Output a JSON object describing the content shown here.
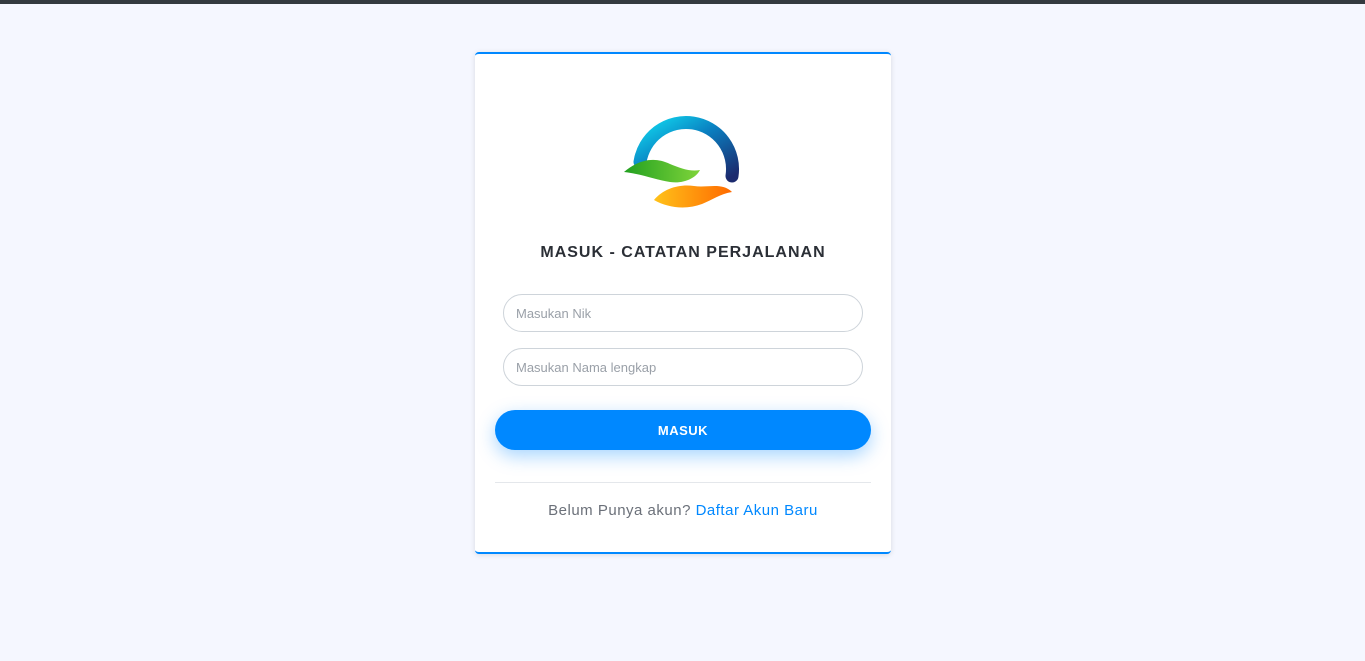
{
  "page": {
    "background_color": "#f5f7ff",
    "top_strip_color": "#343a40"
  },
  "login": {
    "logo_icon": "hands-ring-logo-icon",
    "title": "MASUK - CATATAN PERJALANAN",
    "nik_input": {
      "placeholder": "Masukan Nik",
      "value": ""
    },
    "name_input": {
      "placeholder": "Masukan Nama lengkap",
      "value": ""
    },
    "submit_label": "MASUK",
    "signup_prompt": "Belum Punya akun?",
    "signup_link": "Daftar Akun Baru",
    "accent_color": "#0088ff"
  }
}
